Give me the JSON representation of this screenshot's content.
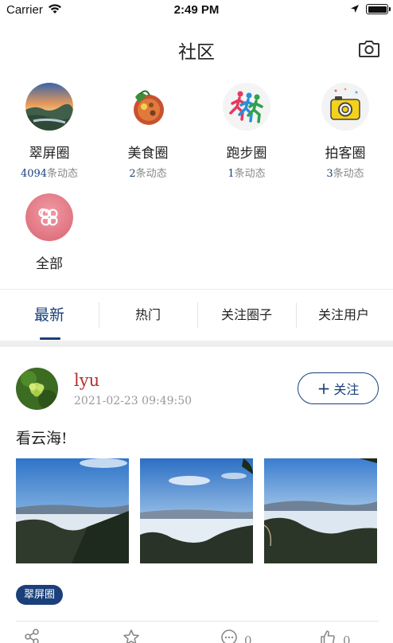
{
  "status_bar": {
    "carrier": "Carrier",
    "time": "2:49 PM"
  },
  "nav": {
    "title": "社区",
    "camera_icon": "camera-icon"
  },
  "circles": [
    {
      "name": "翠屏圈",
      "count": "4094",
      "suffix": "条动态",
      "icon": "landscape-avatar"
    },
    {
      "name": "美食圈",
      "count": "2",
      "suffix": "条动态",
      "icon": "food-avatar"
    },
    {
      "name": "跑步圈",
      "count": "1",
      "suffix": "条动态",
      "icon": "runners-avatar"
    },
    {
      "name": "拍客圈",
      "count": "3",
      "suffix": "条动态",
      "icon": "camera-avatar"
    },
    {
      "name": "全部",
      "icon": "all-grid-avatar"
    }
  ],
  "tabs": [
    {
      "label": "最新",
      "active": true
    },
    {
      "label": "热门",
      "active": false
    },
    {
      "label": "关注圈子",
      "active": false
    },
    {
      "label": "关注用户",
      "active": false
    }
  ],
  "post": {
    "username": "lyu",
    "timestamp": "2021-02-23 09:49:50",
    "follow_label": "关注",
    "text": "看云海!",
    "tag": "翠屏圈",
    "actions": {
      "share": "",
      "favorite": "",
      "comments": "0",
      "likes": "0"
    }
  },
  "colors": {
    "accent": "#1a3f7a",
    "username": "#b5302a",
    "muted": "#888888"
  }
}
